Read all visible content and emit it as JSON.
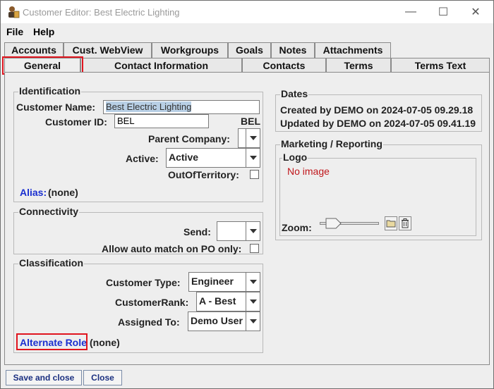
{
  "window": {
    "title": "Customer Editor: Best Electric Lighting",
    "minimize_glyph": "—",
    "maximize_glyph": "☐",
    "close_glyph": "✕"
  },
  "menu": {
    "file": "File",
    "help": "Help"
  },
  "tabs_row1": [
    "Accounts",
    "Cust. WebView",
    "Workgroups",
    "Goals",
    "Notes",
    "Attachments"
  ],
  "tabs_row2": [
    "General",
    "Contact Information",
    "Contacts",
    "Terms",
    "Terms Text"
  ],
  "identification": {
    "legend": "Identification",
    "customer_name_label": "Customer Name:",
    "customer_name_value": "Best Electric Lighting",
    "customer_id_label": "Customer ID:",
    "customer_id_value": "BEL",
    "customer_code": "BEL",
    "parent_company_label": "Parent Company:",
    "parent_company_value": "",
    "active_label": "Active:",
    "active_value": "Active",
    "out_of_territory_label": "OutOfTerritory:",
    "alias_label": "Alias:",
    "alias_value": "(none)"
  },
  "connectivity": {
    "legend": "Connectivity",
    "send_label": "Send:",
    "send_value": "",
    "auto_match_label": "Allow auto match on PO only:"
  },
  "classification": {
    "legend": "Classification",
    "customer_type_label": "Customer Type:",
    "customer_type_value": "Engineer",
    "customer_rank_label": "CustomerRank:",
    "customer_rank_value": "A - Best",
    "assigned_to_label": "Assigned To:",
    "assigned_to_value": "Demo User",
    "alternate_role_label": "Alternate Role",
    "alternate_role_value": "(none)"
  },
  "dates": {
    "legend": "Dates",
    "created_prefix": "Created by",
    "created_user": "DEMO",
    "created_on": "on",
    "created_at": "2024-07-05 09.29.18",
    "updated_prefix": "Updated by",
    "updated_user": "DEMO",
    "updated_on": "on",
    "updated_at": "2024-07-05 09.41.19"
  },
  "marketing": {
    "legend": "Marketing / Reporting",
    "logo_legend": "Logo",
    "no_image": "No image",
    "zoom_label": "Zoom:",
    "zoom_level": 0.15
  },
  "buttons": {
    "save_close": "Save and close",
    "close": "Close"
  },
  "colors": {
    "highlight": "#e0141e",
    "link": "#1a2fd0",
    "no_image": "#c0161b",
    "selection": "#b8cfe5"
  }
}
